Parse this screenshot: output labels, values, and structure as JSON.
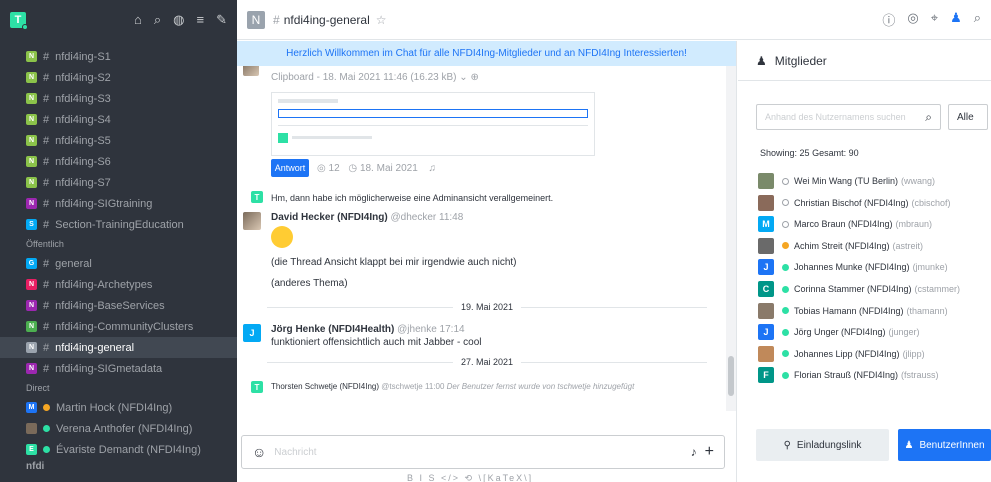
{
  "sidebar": {
    "user_initial": "T",
    "channels_top": [
      {
        "initial": "N",
        "color": "#8bc34a",
        "name": "nfdi4ing-S1"
      },
      {
        "initial": "N",
        "color": "#8bc34a",
        "name": "nfdi4ing-S2"
      },
      {
        "initial": "N",
        "color": "#8bc34a",
        "name": "nfdi4ing-S3"
      },
      {
        "initial": "N",
        "color": "#8bc34a",
        "name": "nfdi4ing-S4"
      },
      {
        "initial": "N",
        "color": "#8bc34a",
        "name": "nfdi4ing-S5"
      },
      {
        "initial": "N",
        "color": "#8bc34a",
        "name": "nfdi4ing-S6"
      },
      {
        "initial": "N",
        "color": "#8bc34a",
        "name": "nfdi4ing-S7"
      },
      {
        "initial": "N",
        "color": "#9c27b0",
        "name": "nfdi4ing-SIGtraining"
      },
      {
        "initial": "S",
        "color": "#03a9f4",
        "name": "Section-TrainingEducation"
      }
    ],
    "section_public": "Öffentlich",
    "channels_public": [
      {
        "initial": "G",
        "color": "#03a9f4",
        "name": "general"
      },
      {
        "initial": "N",
        "color": "#e91e63",
        "name": "nfdi4ing-Archetypes"
      },
      {
        "initial": "N",
        "color": "#9c27b0",
        "name": "nfdi4ing-BaseServices"
      },
      {
        "initial": "N",
        "color": "#4caf50",
        "name": "nfdi4ing-CommunityClusters"
      },
      {
        "initial": "N",
        "color": "#9aa3ad",
        "name": "nfdi4ing-general"
      },
      {
        "initial": "N",
        "color": "#9c27b0",
        "name": "nfdi4ing-SIGmetadata"
      }
    ],
    "section_direct": "Direct",
    "direct": [
      {
        "initial": "M",
        "color": "#1d74f5",
        "status": "#f5a623",
        "name": "Martin Hock (NFDI4Ing)"
      },
      {
        "initial": "",
        "color": "#7a6a5a",
        "status": "#2de0a5",
        "name": "Verena Anthofer (NFDI4Ing)"
      },
      {
        "initial": "E",
        "color": "#2de0a5",
        "status": "#2de0a5",
        "name": "Évariste Demandt (NFDI4Ing)"
      }
    ],
    "footer": "nfdi"
  },
  "header": {
    "room_initial": "N",
    "room_name": "nfdi4ing-general"
  },
  "chat": {
    "banner": "Herzlich Willkommen im Chat für alle NFDI4Ing-Mitglieder und an NFDI4Ing Interessierten!",
    "clip_caption": "Clipboard - 18. Mai 2021 11:46 (16.23 kB)",
    "antwort": "Antwort",
    "thread_count": "12",
    "thread_date": "18. Mai 2021",
    "sys_msg": "Hm, dann habe ich möglicherweise eine Adminansicht verallgemeinert.",
    "msg1_user": "David Hecker (NFDI4Ing)",
    "msg1_handle": "@dhecker",
    "msg1_time": "11:48",
    "msg1_line1": "(die Thread Ansicht klappt bei mir irgendwie auch nicht)",
    "msg1_line2": "(anderes Thema)",
    "date1": "19. Mai 2021",
    "msg2_initial": "J",
    "msg2_user": "Jörg Henke (NFDI4Health)",
    "msg2_handle": "@jhenke",
    "msg2_time": "17:14",
    "msg2_text": "funktioniert offensichtlich auch mit Jabber - cool",
    "date2": "27. Mai 2021",
    "sys2_user": "Thorsten Schwetje (NFDI4Ing)",
    "sys2_handle": "@tschwetje",
    "sys2_time": "11:00",
    "sys2_text": "Der Benutzer fernst wurde von tschwetje hinzugefügt",
    "placeholder": "Nachricht",
    "format_bar": "B I S </> ⟲ \\[KaTeX\\]"
  },
  "members": {
    "title": "Mitglieder",
    "search_placeholder": "Anhand des Nutzernamens suchen",
    "filter": "Alle",
    "showing": "Showing: 25",
    "total": "Gesamt: 90",
    "list": [
      {
        "initial": "",
        "color": "#7a8a6a",
        "status": "offline",
        "name": "Wei Min Wang (TU Berlin)",
        "user": "(wwang)"
      },
      {
        "initial": "",
        "color": "#8a6a5a",
        "status": "offline",
        "name": "Christian Bischof (NFDI4Ing)",
        "user": "(cbischof)"
      },
      {
        "initial": "M",
        "color": "#03a9f4",
        "status": "offline",
        "name": "Marco Braun (NFDI4Ing)",
        "user": "(mbraun)"
      },
      {
        "initial": "",
        "color": "#6a6a6a",
        "status": "away",
        "name": "Achim Streit (NFDI4Ing)",
        "user": "(astreit)"
      },
      {
        "initial": "J",
        "color": "#1d74f5",
        "status": "online",
        "name": "Johannes Munke (NFDI4Ing)",
        "user": "(jmunke)"
      },
      {
        "initial": "C",
        "color": "#009688",
        "status": "online",
        "name": "Corinna Stammer (NFDI4Ing)",
        "user": "(cstammer)"
      },
      {
        "initial": "",
        "color": "#8a7a6a",
        "status": "online",
        "name": "Tobias Hamann (NFDI4Ing)",
        "user": "(thamann)"
      },
      {
        "initial": "J",
        "color": "#1d74f5",
        "status": "online",
        "name": "Jörg Unger (NFDI4Ing)",
        "user": "(junger)"
      },
      {
        "initial": "",
        "color": "#c0895a",
        "status": "online",
        "name": "Johannes Lipp (NFDI4Ing)",
        "user": "(jlipp)"
      },
      {
        "initial": "F",
        "color": "#009688",
        "status": "online",
        "name": "Florian Strauß (NFDI4Ing)",
        "user": "(fstrauss)"
      }
    ],
    "invite": "Einladungslink",
    "add": "BenutzerInnen"
  }
}
